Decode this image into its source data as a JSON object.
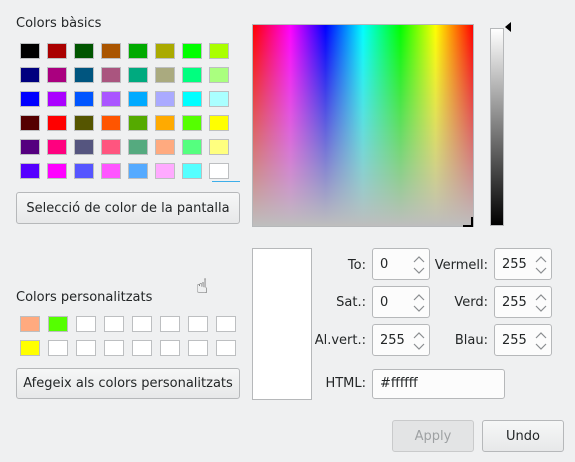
{
  "basic_title": "Colors bàsics",
  "basic_colors": [
    [
      "#000000",
      "#aa0000",
      "#005500",
      "#aa5500",
      "#00aa00",
      "#aaaa00",
      "#00ff00",
      "#aaff00"
    ],
    [
      "#00007f",
      "#aa007f",
      "#00557f",
      "#aa557f",
      "#00aa7f",
      "#aaaa7f",
      "#00ff7f",
      "#aaff7f"
    ],
    [
      "#0000ff",
      "#aa00ff",
      "#0055ff",
      "#aa55ff",
      "#00aaff",
      "#aaaaff",
      "#00ffff",
      "#aaffff"
    ],
    [
      "#550000",
      "#ff0000",
      "#555500",
      "#ff5500",
      "#55aa00",
      "#ffaa00",
      "#55ff00",
      "#ffff00"
    ],
    [
      "#55007f",
      "#ff007f",
      "#55557f",
      "#ff557f",
      "#55aa7f",
      "#ffaa7f",
      "#55ff7f",
      "#ffff7f"
    ],
    [
      "#5500ff",
      "#ff00ff",
      "#5555ff",
      "#ff55ff",
      "#55aaff",
      "#ffaaff",
      "#55ffff",
      "#ffffff"
    ]
  ],
  "pick_screen_button": "Selecció de color de la pantalla",
  "custom_title": "Colors personalitzats",
  "custom_colors": [
    [
      "#ffaa7f",
      "#55ff00",
      "#ffffff",
      "#ffffff",
      "#ffffff",
      "#ffffff",
      "#ffffff",
      "#ffffff"
    ],
    [
      "#ffff00",
      "#ffffff",
      "#ffffff",
      "#ffffff",
      "#ffffff",
      "#ffffff",
      "#ffffff",
      "#ffffff"
    ]
  ],
  "add_custom_button": "Afegeix als colors personalitzats",
  "preview_color": "#ffffff",
  "fields": {
    "hue_label": "To:",
    "hue": "0",
    "sat_label": "Sat.:",
    "sat": "0",
    "val_label": "Al.vert.:",
    "val": "255",
    "red_label": "Vermell:",
    "red": "255",
    "green_label": "Verd:",
    "green": "255",
    "blue_label": "Blau:",
    "blue": "255",
    "html_label": "HTML:",
    "html": "#ffffff"
  },
  "apply_button": "Apply",
  "undo_button": "Undo",
  "accent": "#3daee9"
}
